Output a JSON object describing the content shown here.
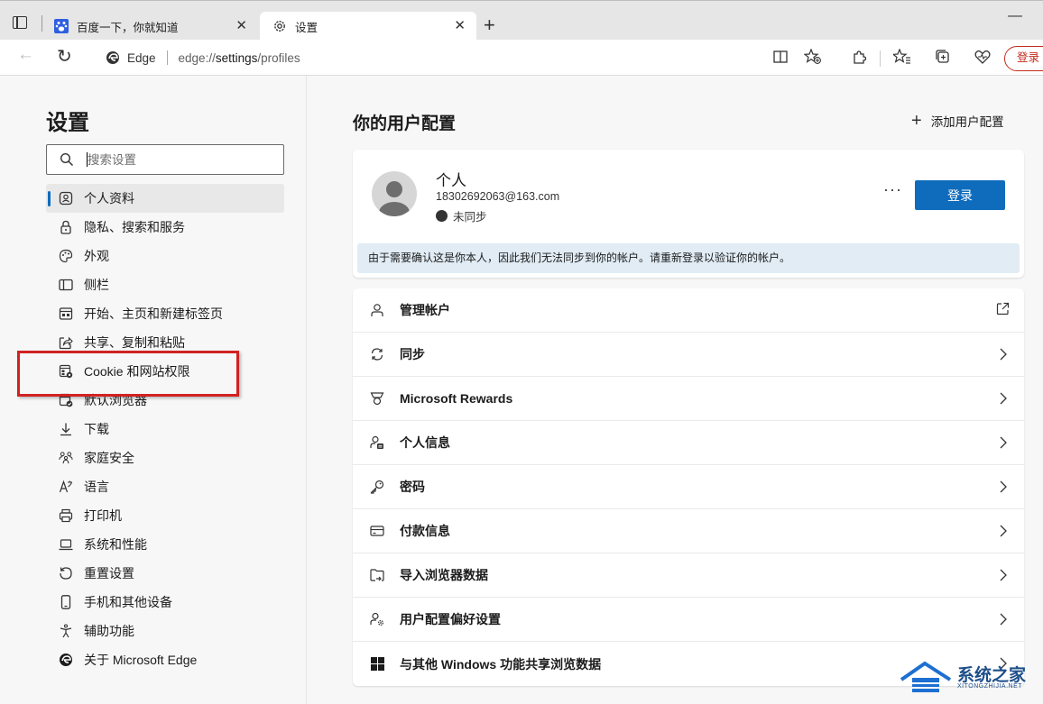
{
  "browser": {
    "tabs": [
      {
        "label": "百度一下，你就知道",
        "icon": "baidu-paw-icon"
      },
      {
        "label": "设置",
        "icon": "gear-icon"
      }
    ],
    "address_site": "Edge",
    "address_url_prefix": "edge://",
    "address_url_path": "settings",
    "address_url_suffix": "/profiles",
    "signin_pill": "登录"
  },
  "sidebar": {
    "title": "设置",
    "search_placeholder": "搜索设置",
    "items": [
      {
        "label": "个人资料",
        "icon": "profile-icon",
        "selected": true
      },
      {
        "label": "隐私、搜索和服务",
        "icon": "lock-icon"
      },
      {
        "label": "外观",
        "icon": "palette-icon"
      },
      {
        "label": "侧栏",
        "icon": "sidebar-icon"
      },
      {
        "label": "开始、主页和新建标签页",
        "icon": "home-tab-icon"
      },
      {
        "label": "共享、复制和粘贴",
        "icon": "share-icon"
      },
      {
        "label": "Cookie 和网站权限",
        "icon": "cookie-permissions-icon"
      },
      {
        "label": "默认浏览器",
        "icon": "default-browser-icon"
      },
      {
        "label": "下载",
        "icon": "download-icon"
      },
      {
        "label": "家庭安全",
        "icon": "family-icon"
      },
      {
        "label": "语言",
        "icon": "language-icon"
      },
      {
        "label": "打印机",
        "icon": "printer-icon"
      },
      {
        "label": "系统和性能",
        "icon": "laptop-icon"
      },
      {
        "label": "重置设置",
        "icon": "reset-icon"
      },
      {
        "label": "手机和其他设备",
        "icon": "phone-icon"
      },
      {
        "label": "辅助功能",
        "icon": "accessibility-icon"
      },
      {
        "label": "关于 Microsoft Edge",
        "icon": "edge-logo-icon"
      }
    ]
  },
  "main": {
    "title": "你的用户配置",
    "add_profile_label": "添加用户配置",
    "profile": {
      "name": "个人",
      "email": "18302692063@163.com",
      "sync_status": "未同步",
      "more": "···",
      "signin_button": "登录",
      "notice": "由于需要确认这是你本人，因此我们无法同步到你的帐户。请重新登录以验证你的帐户。"
    },
    "rows": [
      {
        "label": "管理帐户",
        "icon": "person-outline-icon",
        "action": "external-link-icon"
      },
      {
        "label": "同步",
        "icon": "sync-icon",
        "action": "chevron-right-icon"
      },
      {
        "label": "Microsoft Rewards",
        "icon": "trophy-icon",
        "action": "chevron-right-icon"
      },
      {
        "label": "个人信息",
        "icon": "person-card-icon",
        "action": "chevron-right-icon"
      },
      {
        "label": "密码",
        "icon": "key-icon",
        "action": "chevron-right-icon"
      },
      {
        "label": "付款信息",
        "icon": "credit-card-icon",
        "action": "chevron-right-icon"
      },
      {
        "label": "导入浏览器数据",
        "icon": "import-folder-icon",
        "action": "chevron-right-icon"
      },
      {
        "label": "用户配置偏好设置",
        "icon": "person-gear-icon",
        "action": "chevron-right-icon"
      },
      {
        "label": "与其他 Windows 功能共享浏览数据",
        "icon": "windows-logo-icon",
        "action": "chevron-right-icon"
      }
    ]
  },
  "watermark": {
    "text": "系统之家",
    "subtext": "XITONGZHIJIA.NET"
  },
  "colors": {
    "accent": "#0f6cbd",
    "highlight_box": "#d12222",
    "signin_pill": "#c42b1c"
  }
}
